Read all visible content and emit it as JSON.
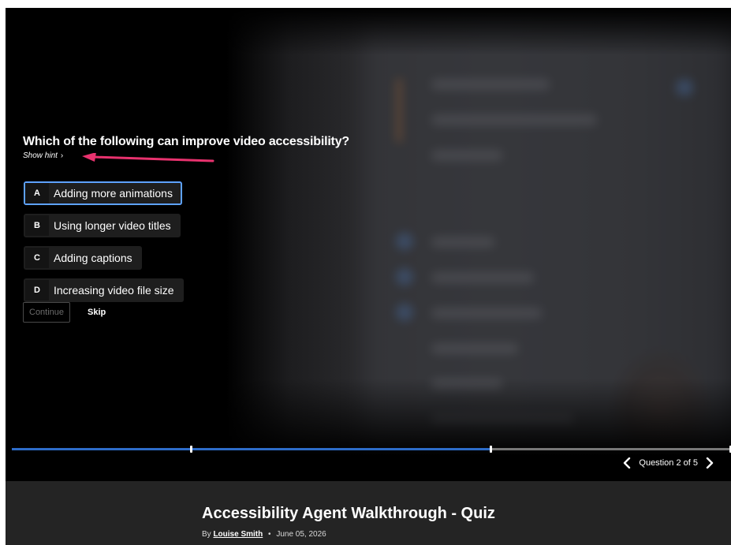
{
  "quiz": {
    "question": "Which of the following can improve video accessibility?",
    "hint_label": "Show hint",
    "options": [
      {
        "letter": "A",
        "text": "Adding more animations",
        "selected": true
      },
      {
        "letter": "B",
        "text": "Using longer video titles",
        "selected": false
      },
      {
        "letter": "C",
        "text": "Adding captions",
        "selected": false
      },
      {
        "letter": "D",
        "text": "Increasing video file size",
        "selected": false
      }
    ],
    "continue_label": "Continue",
    "skip_label": "Skip"
  },
  "progress": {
    "fill_fraction": 0.667,
    "markers": [
      0.25,
      0.667,
      1.0
    ],
    "counter": "Question 2 of 5"
  },
  "video": {
    "title": "Accessibility Agent Walkthrough - Quiz",
    "by": "By",
    "author": "Louise Smith",
    "date": "June 05, 2026"
  },
  "colors": {
    "accent": "#2d6cc8",
    "selected_border": "#5ea2ff",
    "hint_arrow": "#e8326e"
  }
}
